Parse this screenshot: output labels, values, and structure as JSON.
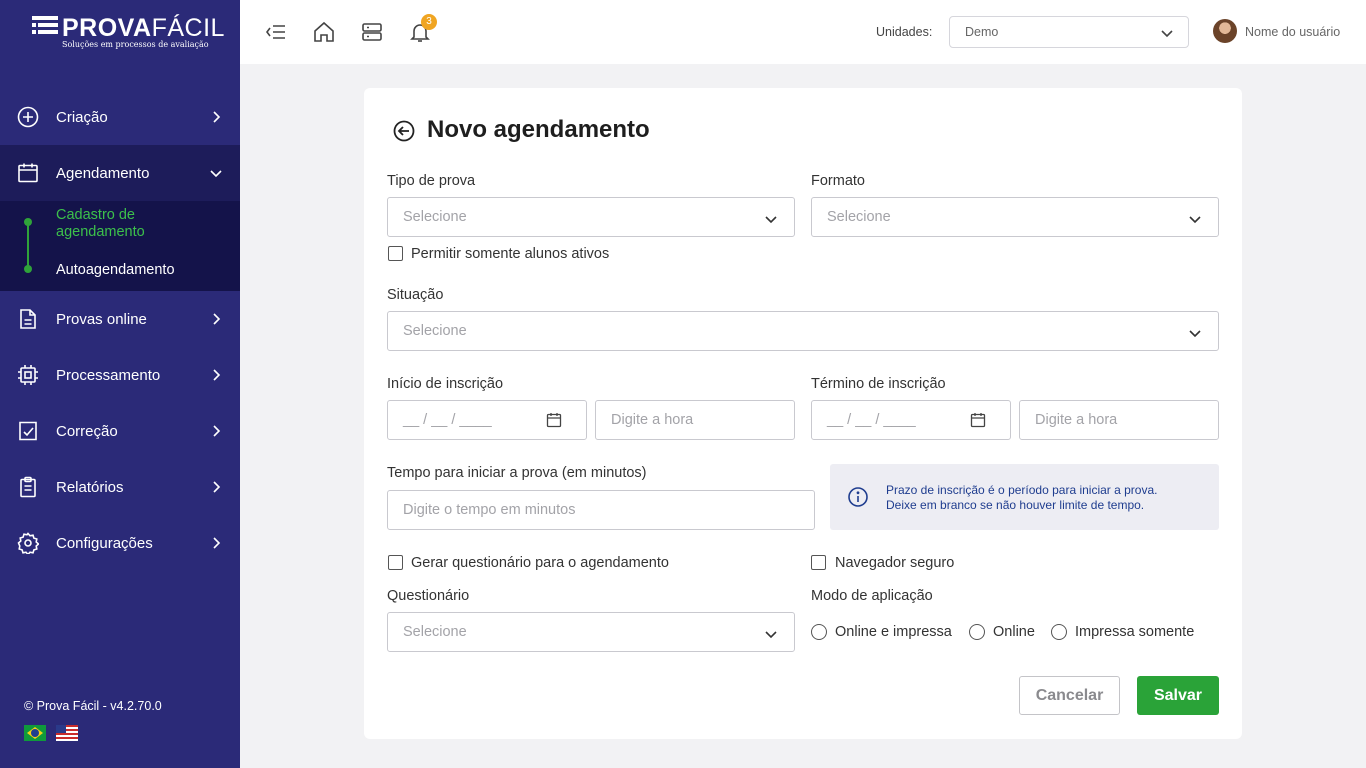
{
  "brand": {
    "name_bold": "PROVA",
    "name_light": "FÁCIL",
    "tagline": "Soluções em processos de avaliação"
  },
  "sidebar": {
    "items": [
      {
        "label": "Criação",
        "icon": "plus-circle-icon"
      },
      {
        "label": "Agendamento",
        "icon": "calendar-icon",
        "expanded": true
      },
      {
        "label": "Provas online",
        "icon": "document-icon"
      },
      {
        "label": "Processamento",
        "icon": "chip-icon"
      },
      {
        "label": "Correção",
        "icon": "check-square-icon"
      },
      {
        "label": "Relatórios",
        "icon": "clipboard-icon"
      },
      {
        "label": "Configurações",
        "icon": "gear-icon"
      }
    ],
    "subitems": [
      {
        "label": "Cadastro de agendamento",
        "active": true
      },
      {
        "label": "Autoagendamento",
        "active": false
      }
    ],
    "version": "© Prova Fácil - v4.2.70.0",
    "languages": [
      "pt-BR",
      "en-US"
    ]
  },
  "topbar": {
    "notification_count": "3",
    "unidades_label": "Unidades:",
    "unidades_value": "Demo",
    "user_name": "Nome do usuário"
  },
  "form": {
    "title": "Novo agendamento",
    "tipo_label": "Tipo de prova",
    "tipo_placeholder": "Selecione",
    "formato_label": "Formato",
    "formato_placeholder": "Selecione",
    "ativos_label": "Permitir somente alunos ativos",
    "situacao_label": "Situação",
    "situacao_placeholder": "Selecione",
    "inicio_label": "Início de inscrição",
    "inicio_date": "__ / __ / ____",
    "inicio_hora": "Digite a hora",
    "termino_label": "Término de inscrição",
    "termino_date": "__ / __ / ____",
    "termino_hora": "Digite a hora",
    "tempo_label": "Tempo para iniciar a prova (em minutos)",
    "tempo_placeholder": "Digite o tempo em minutos",
    "info_line1": "Prazo de inscrição é o período para iniciar a prova.",
    "info_line2": "Deixe em branco se não houver limite de tempo.",
    "gerar_label": "Gerar questionário para o agendamento",
    "navegador_label": "Navegador seguro",
    "questionario_label": "Questionário",
    "questionario_placeholder": "Selecione",
    "modo_label": "Modo de aplicação",
    "modo_options": [
      "Online e impressa",
      "Online",
      "Impressa somente"
    ],
    "cancel_label": "Cancelar",
    "save_label": "Salvar"
  },
  "colors": {
    "sidebar": "#2b2a78",
    "sidebar_active": "#14134a",
    "accent_green": "#2aa338",
    "info_bg": "#ededf3",
    "info_text": "#1f3d8f",
    "badge": "#f0a522"
  }
}
